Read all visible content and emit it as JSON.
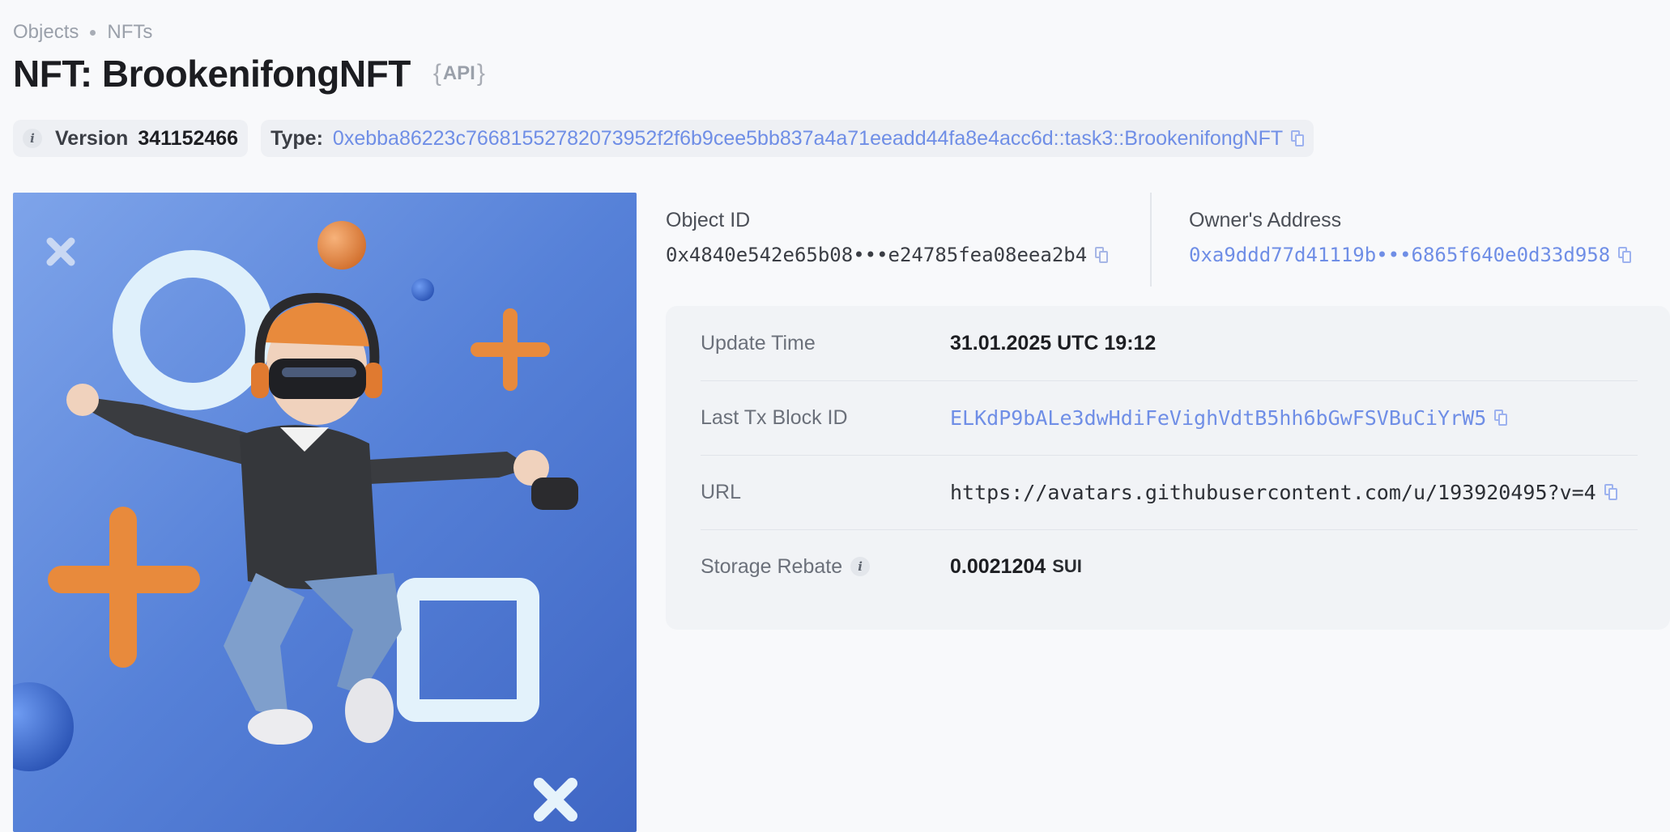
{
  "breadcrumb": {
    "items": [
      "Objects",
      "NFTs"
    ]
  },
  "header": {
    "title": "NFT: BrookenifongNFT",
    "api_label": "API"
  },
  "meta": {
    "version_label": "Version",
    "version_value": "341152466",
    "type_label": "Type:",
    "type_value": "0xebba86223c76681552782073952f2f6b9cee5bb837a4a71eeadd44fa8e4acc6d::task3::BrookenifongNFT"
  },
  "object": {
    "id_label": "Object ID",
    "id_value": "0x4840e542e65b08•••e24785fea08eea2b4",
    "owner_label": "Owner's Address",
    "owner_value": "0xa9ddd77d41119b•••6865f640e0d33d958"
  },
  "details": {
    "update_time_label": "Update Time",
    "update_time_value": "31.01.2025 UTC 19:12",
    "last_tx_label": "Last Tx Block ID",
    "last_tx_value": "ELKdP9bALe3dwHdiFeVighVdtB5hh6bGwFSVBuCiYrW5",
    "url_label": "URL",
    "url_value": "https://avatars.githubusercontent.com/u/193920495?v=4",
    "storage_rebate_label": "Storage Rebate",
    "storage_rebate_value": "0.0021204",
    "storage_rebate_unit": "SUI"
  },
  "colors": {
    "accent": "#6f8ee6",
    "background": "#f8f9fb",
    "panel": "#f1f3f6",
    "image_bg": "#4f79d3"
  },
  "icons": {
    "info": "info-icon",
    "copy": "copy-icon"
  }
}
